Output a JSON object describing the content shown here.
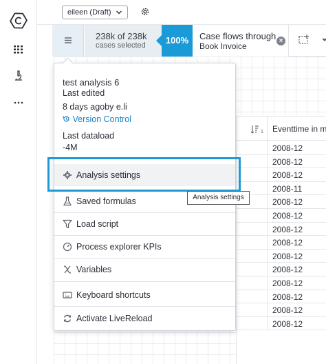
{
  "topbar": {
    "sheet_name": "eileen (Draft)"
  },
  "selection": {
    "cases_count": "238k of 238k",
    "cases_label": "cases selected",
    "percent": "100%",
    "filter_line1": "Case flows through",
    "filter_line2": "Book Invoice"
  },
  "analysis": {
    "name": "test analysis 6",
    "last_edited_label": "Last edited",
    "last_edited_value": "8 days agoby e.li",
    "version_control": "Version Control",
    "last_dataload_label": "Last dataload",
    "last_dataload_value": "-4M"
  },
  "menu": {
    "items": [
      {
        "label": "Analysis settings",
        "icon": "gear-icon"
      },
      {
        "label": "Saved formulas",
        "icon": "flask-icon"
      },
      {
        "label": "Load script",
        "icon": "funnel-icon"
      },
      {
        "label": "Process explorer KPIs",
        "icon": "gauge-icon"
      },
      {
        "label": "Variables",
        "icon": "variable-icon"
      },
      {
        "label": "Keyboard shortcuts",
        "icon": "keyboard-icon"
      },
      {
        "label": "Activate LiveReload",
        "icon": "refresh-icon"
      }
    ]
  },
  "tooltip": "Analysis settings",
  "table": {
    "sort_indicator": "1",
    "column_header": "Eventtime in m",
    "rows": [
      "2008-12",
      "2008-12",
      "2008-12",
      "2008-11",
      "2008-12",
      "2008-12",
      "2008-12",
      "2008-12",
      "2008-12",
      "2008-12",
      "2008-12",
      "2008-12",
      "2008-12",
      "2008-12"
    ]
  },
  "colors": {
    "accent": "#1a9ad6",
    "link": "#1a82c4",
    "highlight_border": "#1b9ad6"
  }
}
